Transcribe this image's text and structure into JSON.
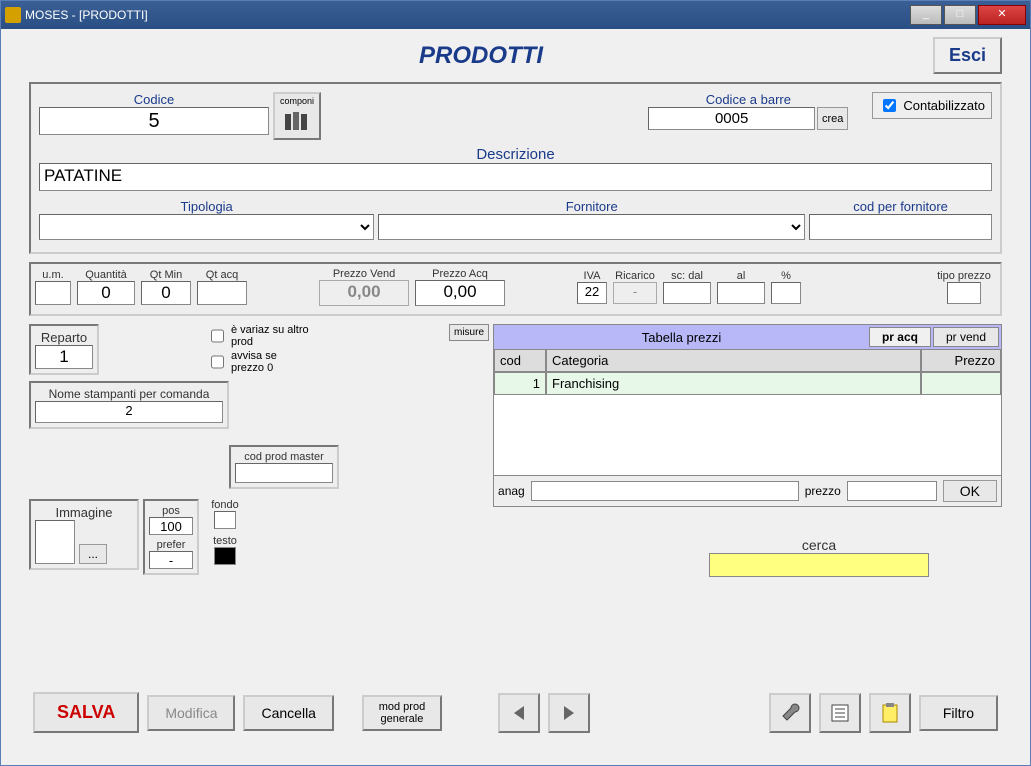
{
  "window": {
    "title": "MOSES - [PRODOTTI]"
  },
  "header": {
    "title": "PRODOTTI",
    "esci": "Esci"
  },
  "codice": {
    "label": "Codice",
    "value": "5"
  },
  "componi": {
    "label": "componi"
  },
  "codice_barre": {
    "label": "Codice a barre",
    "value": "0005",
    "crea": "crea"
  },
  "contabilizzato": {
    "label": "Contabilizzato"
  },
  "descrizione": {
    "label": "Descrizione",
    "value": "PATATINE"
  },
  "tipologia": {
    "label": "Tipologia",
    "value": ""
  },
  "fornitore": {
    "label": "Fornitore",
    "value": ""
  },
  "cod_fornitore": {
    "label": "cod per fornitore",
    "value": ""
  },
  "um": {
    "label": "u.m.",
    "value": ""
  },
  "quantita": {
    "label": "Quantità",
    "value": "0"
  },
  "qtmin": {
    "label": "Qt Min",
    "value": "0"
  },
  "qtacq": {
    "label": "Qt acq",
    "value": ""
  },
  "prezzo_vend": {
    "label": "Prezzo Vend",
    "value": "0,00"
  },
  "prezzo_acq": {
    "label": "Prezzo Acq",
    "value": "0,00"
  },
  "iva": {
    "label": "IVA",
    "value": "22"
  },
  "ricarico": {
    "label": "Ricarico",
    "value": "-"
  },
  "sc_dal": {
    "label": "sc: dal",
    "value": ""
  },
  "al": {
    "label": "al",
    "value": ""
  },
  "pct": {
    "label": "%",
    "value": ""
  },
  "tipo_prezzo": {
    "label": "tipo prezzo",
    "value": ""
  },
  "reparto": {
    "label": "Reparto",
    "value": "1"
  },
  "variaz": {
    "label": "è variaz su altro prod"
  },
  "avvisa": {
    "label": "avvisa se prezzo 0"
  },
  "misure": {
    "label": "misure"
  },
  "stampanti": {
    "label": "Nome stampanti per comanda",
    "value": "2"
  },
  "cod_master": {
    "label": "cod prod master",
    "value": ""
  },
  "immagine": {
    "label": "Immagine",
    "browse": "..."
  },
  "pos": {
    "label": "pos",
    "value": "100"
  },
  "prefer": {
    "label": "prefer",
    "value": "-"
  },
  "fondo": {
    "label": "fondo"
  },
  "testo": {
    "label": "testo"
  },
  "tabella": {
    "title": "Tabella prezzi",
    "tab_acq": "pr acq",
    "tab_vend": "pr vend",
    "col_cod": "cod",
    "col_cat": "Categoria",
    "col_prezzo": "Prezzo",
    "rows": [
      {
        "cod": "1",
        "cat": "Franchising",
        "prezzo": ""
      }
    ],
    "anag": "anag",
    "prezzo_lbl": "prezzo",
    "ok": "OK"
  },
  "cerca": {
    "label": "cerca",
    "value": ""
  },
  "footer": {
    "salva": "SALVA",
    "modifica": "Modifica",
    "cancella": "Cancella",
    "mod_prod": "mod prod generale",
    "filtro": "Filtro"
  }
}
